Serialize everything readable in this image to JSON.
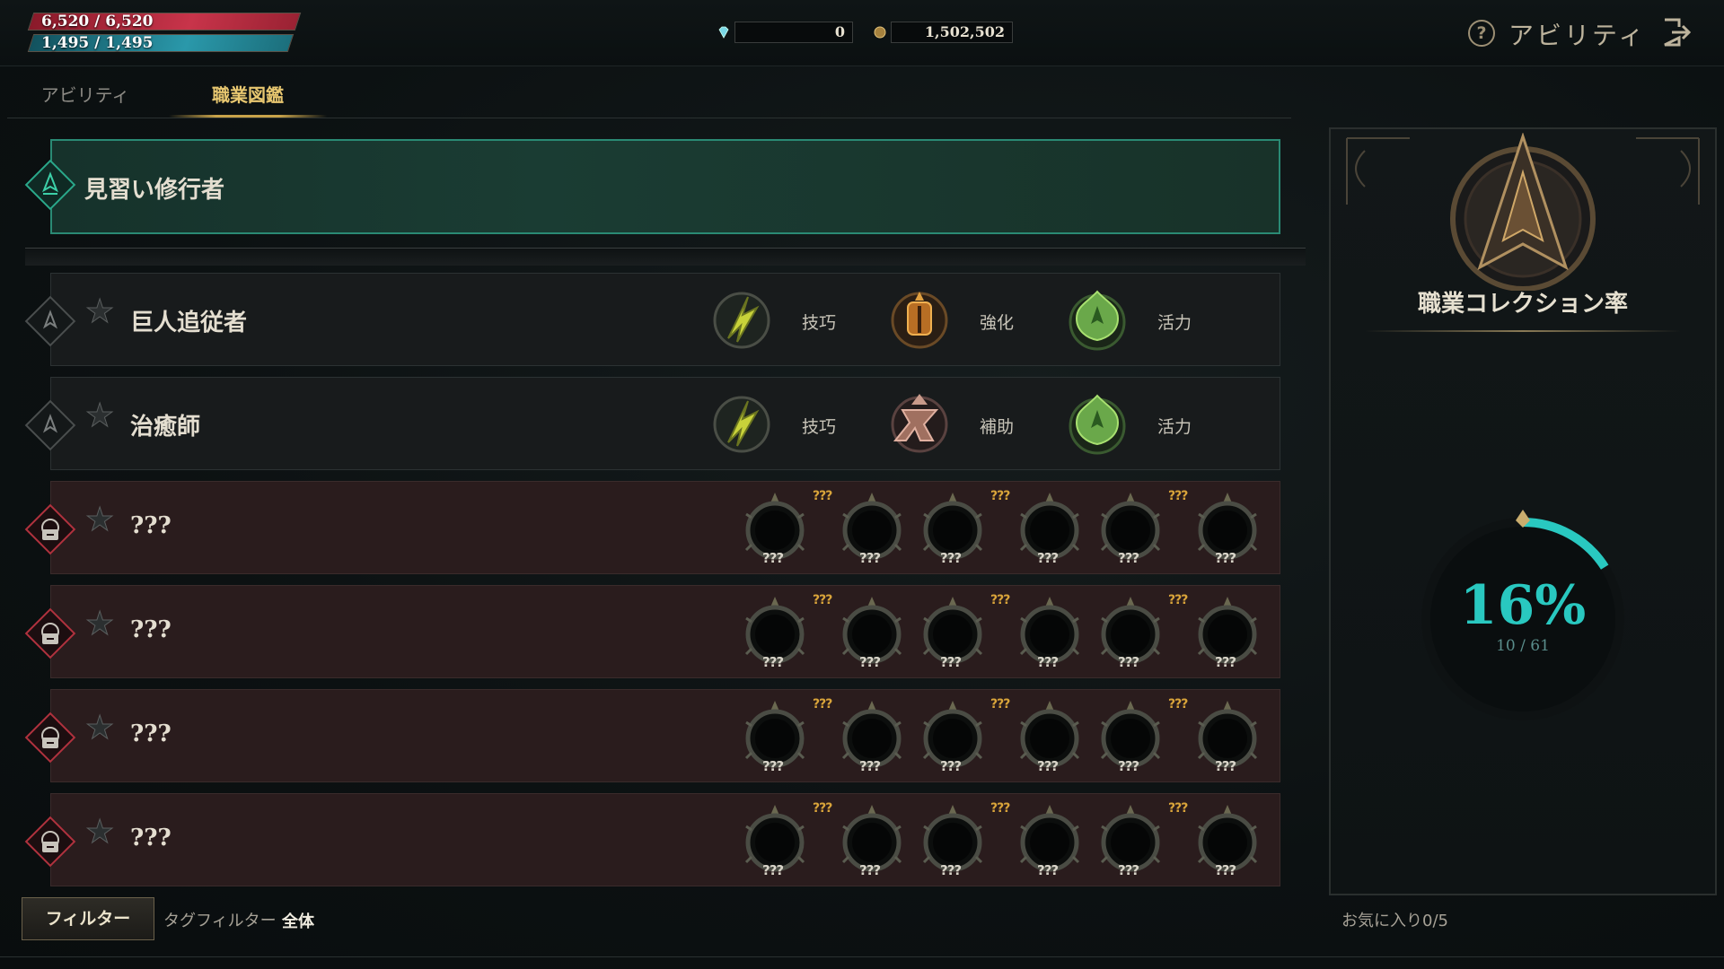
{
  "status": {
    "hp": "6,520 / 6,520",
    "mp": "1,495 / 1,495",
    "hp_color": "#c8344a",
    "mp_color": "#2a98aa"
  },
  "currency": {
    "gems": "0",
    "gold": "1,502,502"
  },
  "header": {
    "title": "アビリティ",
    "help_icon": "?"
  },
  "tabs": [
    {
      "label": "アビリティ",
      "active": false
    },
    {
      "label": "職業図鑑",
      "active": true
    }
  ],
  "job_list": {
    "current": {
      "name": "見習い修行者"
    },
    "rows": [
      {
        "name": "巨人追従者",
        "locked": false,
        "skills": [
          {
            "icon": "dexterity-icon",
            "label": "技巧"
          },
          {
            "icon": "enhance-icon",
            "label": "強化"
          },
          {
            "icon": "vitality-icon",
            "label": "活力"
          }
        ]
      },
      {
        "name": "治癒師",
        "locked": false,
        "skills": [
          {
            "icon": "dexterity-icon",
            "label": "技巧"
          },
          {
            "icon": "support-icon",
            "label": "補助"
          },
          {
            "icon": "vitality-icon",
            "label": "活力"
          }
        ]
      },
      {
        "name": "???",
        "locked": true
      },
      {
        "name": "???",
        "locked": true
      },
      {
        "name": "???",
        "locked": true
      },
      {
        "name": "???",
        "locked": true
      }
    ],
    "locked_slot_label": "???",
    "locked_tag_label": "???"
  },
  "collection": {
    "title": "職業コレクション率",
    "percent_text": "16%",
    "count_text": "10 / 61",
    "progress": 0.16,
    "accent": "#29c8c0"
  },
  "footer": {
    "filter_button": "フィルター",
    "tag_filter_label": "タグフィルター",
    "tag_filter_value": "全体",
    "favorites": "お気に入り0/5"
  }
}
